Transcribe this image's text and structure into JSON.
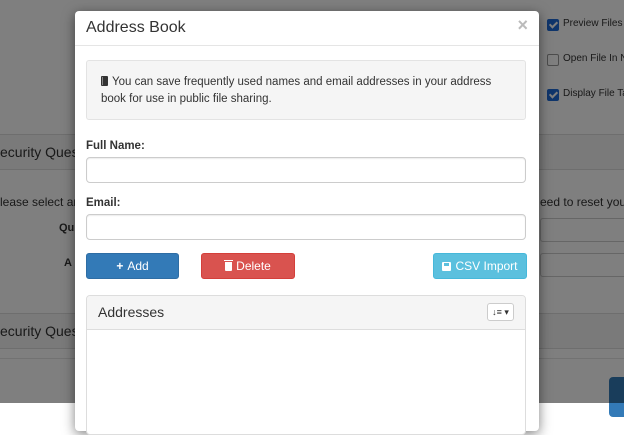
{
  "background": {
    "settings": [
      {
        "label": "Preview Files B",
        "checked": true
      },
      {
        "label": "Open File In N",
        "checked": false
      },
      {
        "label": "Display File Ta",
        "checked": true
      }
    ],
    "security_heading_1": "ecurity Quest",
    "security_desc_left": "lease select an",
    "security_desc_right": "eed to reset your",
    "label_q": "Qu",
    "label_a": "A",
    "security_heading_2": "ecurity Quest"
  },
  "modal": {
    "title": "Address Book",
    "close_label": "×",
    "info_text": "You can save frequently used names and email addresses in your address book for use in public file sharing.",
    "full_name_label": "Full Name:",
    "full_name_value": "",
    "email_label": "Email:",
    "email_value": "",
    "add_label": "Add",
    "delete_label": "Delete",
    "csv_label": "CSV Import",
    "addresses_title": "Addresses",
    "sort_label": "↓≡ ▾"
  },
  "colors": {
    "primary": "#337ab7",
    "danger": "#d9534f",
    "info": "#5bc0de"
  }
}
